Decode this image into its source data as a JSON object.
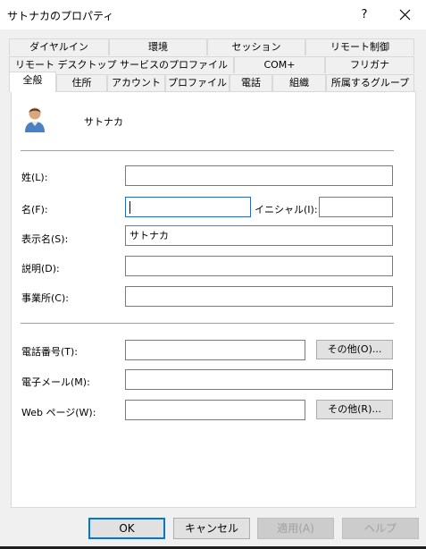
{
  "window": {
    "title": "サトナカのプロパティ",
    "help_label": "?"
  },
  "tabs": {
    "row1": [
      "ダイヤルイン",
      "環境",
      "セッション",
      "リモート制御"
    ],
    "row2": [
      "リモート デスクトップ サービスのプロファイル",
      "COM+",
      "フリガナ"
    ],
    "row3": [
      "全般",
      "住所",
      "アカウント",
      "プロファイル",
      "電話",
      "組織",
      "所属するグループ"
    ],
    "active": "全般"
  },
  "general": {
    "user_display": "サトナカ",
    "last_name_label": "姓(L):",
    "last_name_value": "",
    "first_name_label": "名(F):",
    "first_name_value": "",
    "initials_label": "イニシャル(I):",
    "initials_value": "",
    "display_name_label": "表示名(S):",
    "display_name_value": "サトナカ",
    "description_label": "説明(D):",
    "description_value": "",
    "office_label": "事業所(C):",
    "office_value": "",
    "phone_label": "電話番号(T):",
    "phone_value": "",
    "phone_other_button": "その他(O)...",
    "email_label": "電子メール(M):",
    "email_value": "",
    "webpage_label": "Web ページ(W):",
    "webpage_value": "",
    "webpage_other_button": "その他(R)..."
  },
  "buttons": {
    "ok": "OK",
    "cancel": "キャンセル",
    "apply": "適用(A)",
    "help": "ヘルプ"
  },
  "colors": {
    "accent": "#0078d7",
    "panel": "#ffffff",
    "background": "#f0f0f0"
  }
}
